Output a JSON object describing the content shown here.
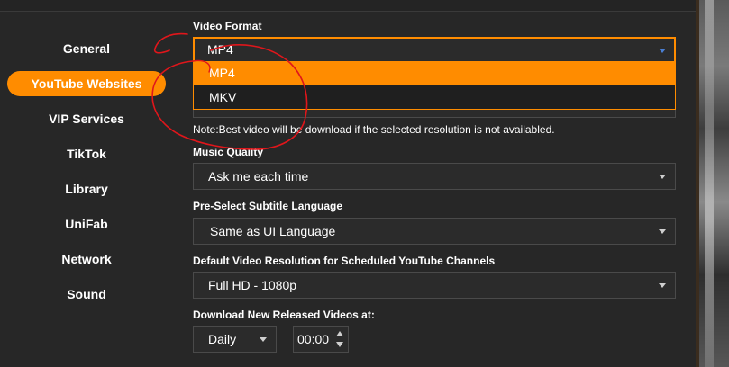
{
  "nav": {
    "items": [
      {
        "label": "General"
      },
      {
        "label": "YouTube Websites"
      },
      {
        "label": "VIP Services"
      },
      {
        "label": "TikTok"
      },
      {
        "label": "Library"
      },
      {
        "label": "UniFab"
      },
      {
        "label": "Network"
      },
      {
        "label": "Sound"
      }
    ],
    "active_index": 1
  },
  "video_format": {
    "label": "Video Format",
    "value": "MP4",
    "options": [
      "MP4",
      "MKV"
    ]
  },
  "note": "Note:Best video will be download if the selected resolution is not availabled.",
  "music_quality": {
    "label": "Music Quality",
    "value": "Ask me each time"
  },
  "subtitle": {
    "label": "Pre-Select Subtitle Language",
    "value": "Same as UI Language"
  },
  "resolution": {
    "label": "Default Video Resolution for Scheduled YouTube Channels",
    "value": "Full HD - 1080p"
  },
  "download": {
    "label": "Download New Released Videos at:",
    "frequency": "Daily",
    "time": "00:00"
  },
  "colors": {
    "accent": "#ff8c00",
    "panel": "#272727",
    "annotation": "#e0161b"
  }
}
